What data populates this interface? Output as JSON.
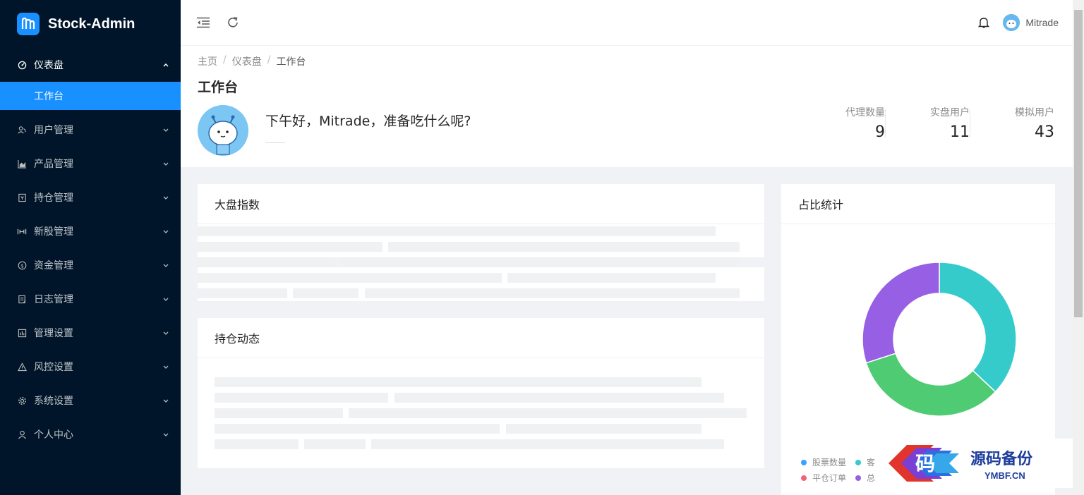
{
  "app": {
    "title": "Stock-Admin"
  },
  "sidebar": {
    "items": [
      {
        "label": "仪表盘",
        "icon": "dashboard-icon",
        "open": true
      },
      {
        "label": "用户管理",
        "icon": "users-icon"
      },
      {
        "label": "产品管理",
        "icon": "area-chart-icon"
      },
      {
        "label": "持仓管理",
        "icon": "holdings-icon"
      },
      {
        "label": "新股管理",
        "icon": "ipo-icon"
      },
      {
        "label": "资金管理",
        "icon": "dollar-icon"
      },
      {
        "label": "日志管理",
        "icon": "log-icon"
      },
      {
        "label": "管理设置",
        "icon": "admin-settings-icon"
      },
      {
        "label": "风控设置",
        "icon": "warning-icon"
      },
      {
        "label": "系统设置",
        "icon": "gear-icon"
      },
      {
        "label": "个人中心",
        "icon": "user-icon"
      }
    ],
    "subitem": {
      "label": "工作台"
    }
  },
  "header": {
    "username": "Mitrade"
  },
  "breadcrumb": [
    "主页",
    "仪表盘",
    "工作台"
  ],
  "page": {
    "title": "工作台",
    "greeting": "下午好，Mitrade，准备吃什么呢?"
  },
  "stats": [
    {
      "label": "代理数量",
      "value": "9"
    },
    {
      "label": "实盘用户",
      "value": "11"
    },
    {
      "label": "模拟用户",
      "value": "43"
    }
  ],
  "cards": {
    "market": {
      "title": "大盘指数"
    },
    "positions": {
      "title": "持仓动态"
    },
    "ratio": {
      "title": "占比统计"
    }
  },
  "chart_data": {
    "type": "pie",
    "donut": true,
    "values": [
      37,
      33,
      30
    ],
    "colors": [
      "#36cbcb",
      "#4ecb73",
      "#975fe4"
    ],
    "legend": [
      {
        "label": "股票数量",
        "color": "#3aa1ff"
      },
      {
        "label": "客",
        "color": "#36cbcb"
      },
      {
        "label": "平仓订单",
        "color": "#f2637b"
      },
      {
        "label": "总",
        "color": "#975fe4"
      }
    ]
  },
  "watermark": {
    "cn": "源码备份",
    "en": "YMBF.CN",
    "glyph": "码"
  }
}
